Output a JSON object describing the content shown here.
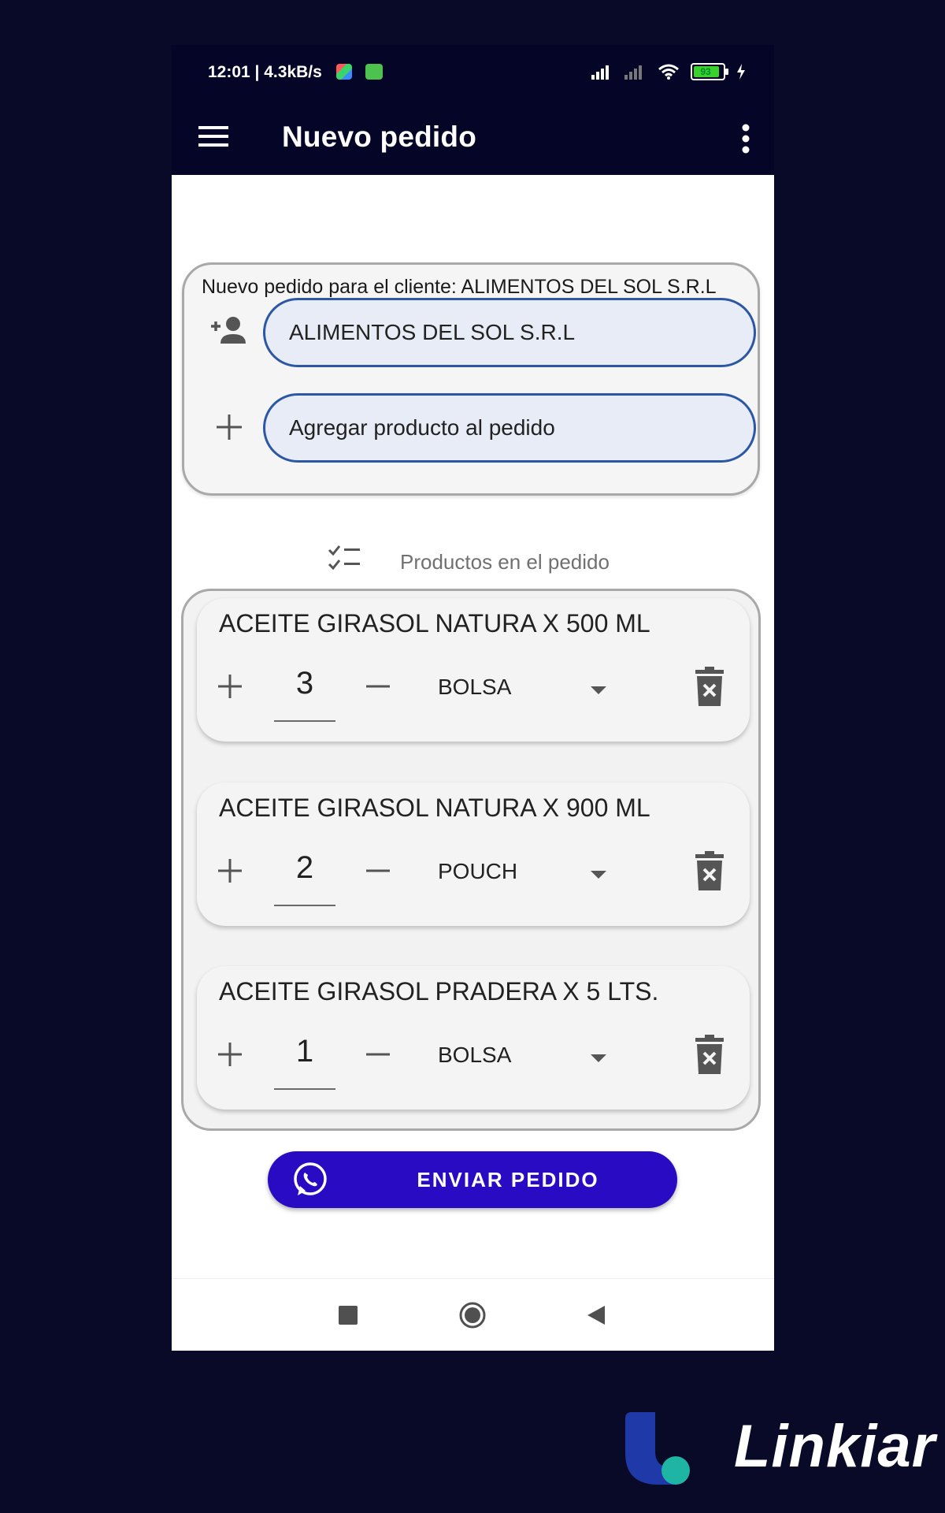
{
  "status_bar": {
    "time_speed": "12:01 | 4.3kB/s",
    "battery_level": "93",
    "icons": [
      "signal-icon",
      "signal-off-icon",
      "wifi-icon",
      "battery-icon",
      "charging-icon"
    ]
  },
  "app_bar": {
    "title": "Nuevo pedido",
    "icons": [
      "menu-icon",
      "more-vert-icon"
    ]
  },
  "customer_card": {
    "caption": "Nuevo pedido para el cliente: ALIMENTOS DEL SOL S.R.L",
    "customer_value": "ALIMENTOS DEL SOL S.R.L",
    "product_placeholder": "Agregar producto al pedido"
  },
  "products_section": {
    "title": "Productos en el pedido",
    "items": [
      {
        "name": "ACEITE GIRASOL NATURA X 500 ML",
        "quantity": "3",
        "unit": "BOLSA"
      },
      {
        "name": "ACEITE GIRASOL NATURA X 900 ML",
        "quantity": "2",
        "unit": "POUCH"
      },
      {
        "name": "ACEITE GIRASOL PRADERA X 5 LTS.",
        "quantity": "1",
        "unit": "BOLSA"
      }
    ]
  },
  "send_button": {
    "label": "ENVIAR PEDIDO",
    "color": "#2a0bc4"
  },
  "brand": {
    "name": "Linkiar",
    "colors": [
      "#1f3aa8",
      "#1fb5a4"
    ]
  },
  "colors": {
    "app_bar": "#050627",
    "background": "#080a28",
    "input_border": "#2b57a5",
    "input_fill": "#e7ecf6"
  }
}
